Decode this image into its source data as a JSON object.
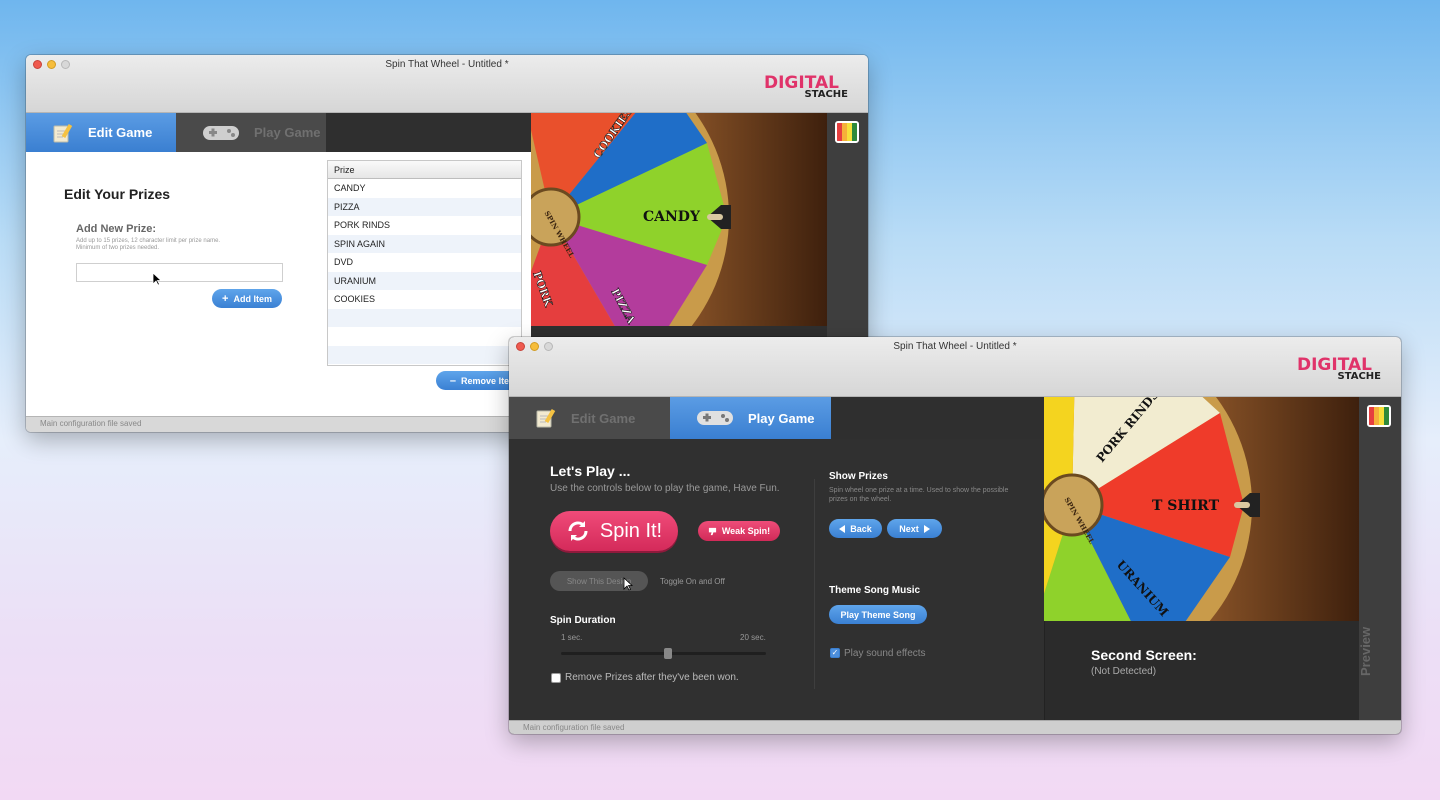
{
  "window_edit": {
    "title": "Spin That Wheel - Untitled *",
    "logo_top": "DIGITAL",
    "logo_bottom": "STACHE",
    "tabs": [
      {
        "label": "Edit Game",
        "active": true
      },
      {
        "label": "Play Game",
        "active": false
      }
    ],
    "heading": "Edit Your Prizes",
    "add_label": "Add New Prize:",
    "hint_line1": "Add up to 15 prizes, 12 character limit per prize name.",
    "hint_line2": "Minimum of two prizes needed.",
    "input_value": "",
    "add_button": "Add Item",
    "remove_button": "Remove Item",
    "table_header": "Prize",
    "prizes": [
      "CANDY",
      "PIZZA",
      "PORK RINDS",
      "SPIN AGAIN",
      "DVD",
      "URANIUM",
      "COOKIES"
    ],
    "wheel_labels": {
      "hub": "SPIN WHEEL",
      "selected": "CANDY",
      "top": "COOKIES",
      "left": "PORK",
      "bottom": "PIZZA"
    },
    "status": "Main configuration file saved"
  },
  "window_play": {
    "title": "Spin That Wheel - Untitled *",
    "logo_top": "DIGITAL",
    "logo_bottom": "STACHE",
    "tabs": [
      {
        "label": "Edit Game",
        "active": false
      },
      {
        "label": "Play Game",
        "active": true
      }
    ],
    "lets_play_title": "Let's Play ...",
    "lets_play_sub": "Use the controls below to play the game, Have Fun.",
    "spin_button": "Spin It!",
    "weak_spin_button": "Weak Spin!",
    "show_button": "Show This Design",
    "toggle_note": "Toggle On and Off",
    "spin_duration_title": "Spin Duration",
    "spin_duration_min": "1 sec.",
    "spin_duration_max": "20 sec.",
    "spin_duration_level": 0.52,
    "remove_prizes_label": "Remove Prizes after they've been won.",
    "remove_prizes_checked": false,
    "show_prizes_title": "Show Prizes",
    "show_prizes_sub": "Spin wheel one prize at a time. Used to show the possible prizes on the wheel.",
    "back_button": "Back",
    "next_button": "Next",
    "theme_title": "Theme Song Music",
    "theme_button": "Play Theme Song",
    "sound_label": "Play sound effects",
    "sound_checked": true,
    "second_screen_title": "Second Screen:",
    "second_screen_status": "(Not Detected)",
    "preview_label": "Preview",
    "wheel_labels": {
      "hub": "SPIN WHEEL",
      "selected": "T SHIRT",
      "top": "PORK RINDS",
      "bottom": "URANIUM"
    },
    "status": "Main configuration file saved"
  },
  "colors": {
    "accent_blue": "#3a7fd1",
    "accent_pink": "#d42a5a",
    "logo_pink": "#e0336a",
    "dark_panel": "#303030"
  }
}
